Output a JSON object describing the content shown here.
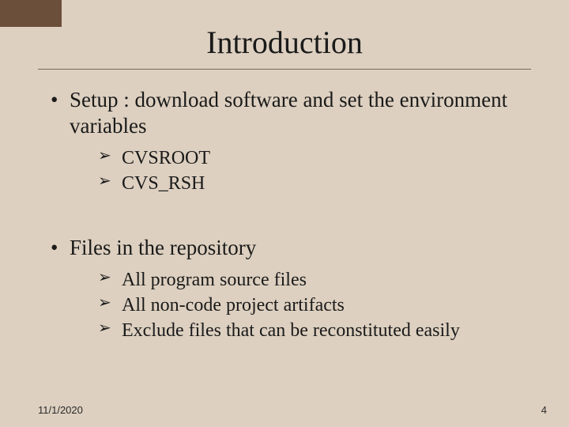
{
  "title": "Introduction",
  "bullets": [
    {
      "text": "Setup : download software and set the environment variables",
      "sub": [
        "CVSROOT",
        "CVS_RSH"
      ]
    },
    {
      "text": "Files in the repository",
      "sub": [
        "All program source files",
        "All non-code project artifacts",
        "Exclude files that can be reconstituted easily"
      ]
    }
  ],
  "footer": {
    "date": "11/1/2020",
    "page": "4"
  }
}
